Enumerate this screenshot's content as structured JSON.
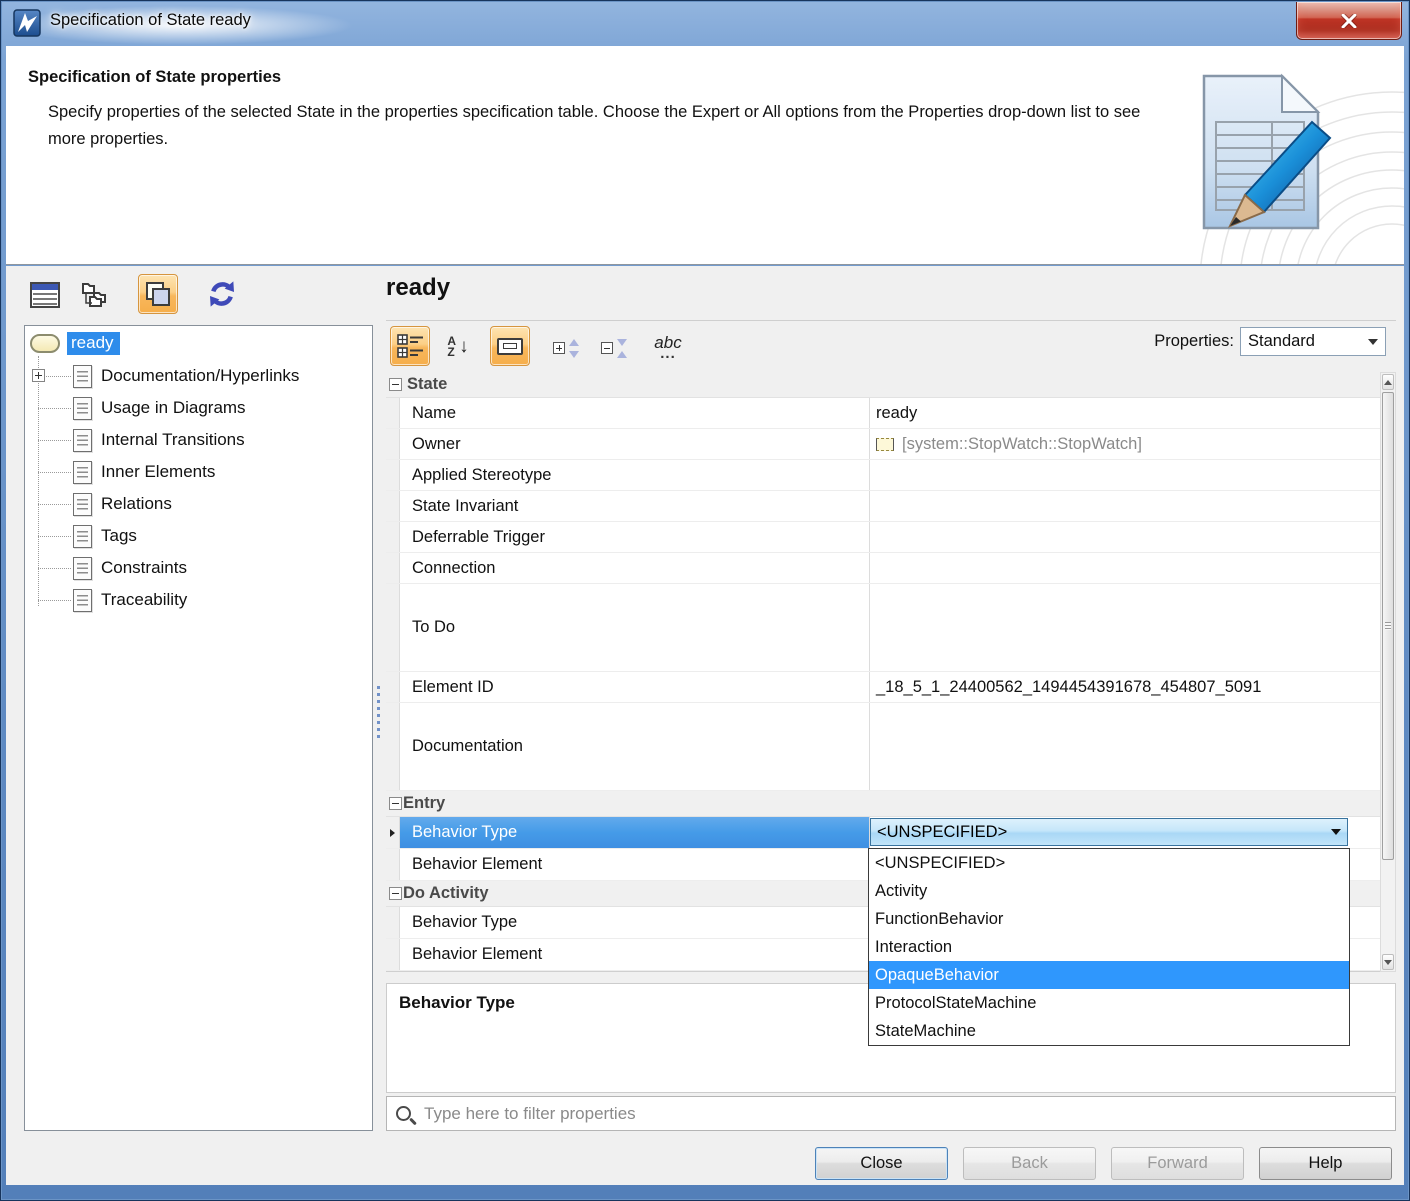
{
  "window": {
    "title": "Specification of State ready"
  },
  "header": {
    "title": "Specification of State properties",
    "description": "Specify properties of the selected State in the properties specification table. Choose the Expert or All options from the Properties drop-down list to see more properties."
  },
  "tree": {
    "root_label": "ready",
    "items": [
      "Documentation/Hyperlinks",
      "Usage in Diagrams",
      "Internal Transitions",
      "Inner Elements",
      "Relations",
      "Tags",
      "Constraints",
      "Traceability"
    ]
  },
  "panel": {
    "heading": "ready",
    "properties_label": "Properties:",
    "properties_value": "Standard"
  },
  "toolbar_icons": {
    "az_a": "A",
    "az_z": "Z",
    "abc": "abc",
    "abc_dots": "..."
  },
  "table": {
    "groups": [
      {
        "label": "State"
      },
      {
        "label": "Entry"
      },
      {
        "label": "Do Activity"
      }
    ],
    "state_rows": [
      {
        "label": "Name",
        "value": "ready"
      },
      {
        "label": "Owner",
        "value": "[system::StopWatch::StopWatch]"
      },
      {
        "label": "Applied Stereotype",
        "value": ""
      },
      {
        "label": "State Invariant",
        "value": ""
      },
      {
        "label": "Deferrable Trigger",
        "value": ""
      },
      {
        "label": "Connection",
        "value": ""
      },
      {
        "label": "To Do",
        "value": ""
      },
      {
        "label": "Element ID",
        "value": "_18_5_1_24400562_1494454391678_454807_5091"
      },
      {
        "label": "Documentation",
        "value": ""
      }
    ],
    "entry_rows": [
      {
        "label": "Behavior Type"
      },
      {
        "label": "Behavior Element"
      }
    ],
    "do_activity_rows": [
      {
        "label": "Behavior Type"
      },
      {
        "label": "Behavior Element"
      }
    ]
  },
  "combo": {
    "value": "<UNSPECIFIED>"
  },
  "dropdown": {
    "options": [
      "<UNSPECIFIED>",
      "Activity",
      "FunctionBehavior",
      "Interaction",
      "OpaqueBehavior",
      "ProtocolStateMachine",
      "StateMachine"
    ],
    "selected": "OpaqueBehavior"
  },
  "description_panel": {
    "title": "Behavior Type"
  },
  "filter": {
    "placeholder": "Type here to filter properties"
  },
  "footer": {
    "buttons": [
      {
        "label": "Close",
        "enabled": true
      },
      {
        "label": "Back",
        "enabled": false
      },
      {
        "label": "Forward",
        "enabled": false
      },
      {
        "label": "Help",
        "enabled": true
      }
    ]
  },
  "colors": {
    "selection_blue": "#2f97fd",
    "row_selection_blue": "#459be8",
    "toolbar_selected_orange": "#f8b75c",
    "titlebar_blue": "#7ba3d4",
    "close_button_red": "#bf3425"
  }
}
